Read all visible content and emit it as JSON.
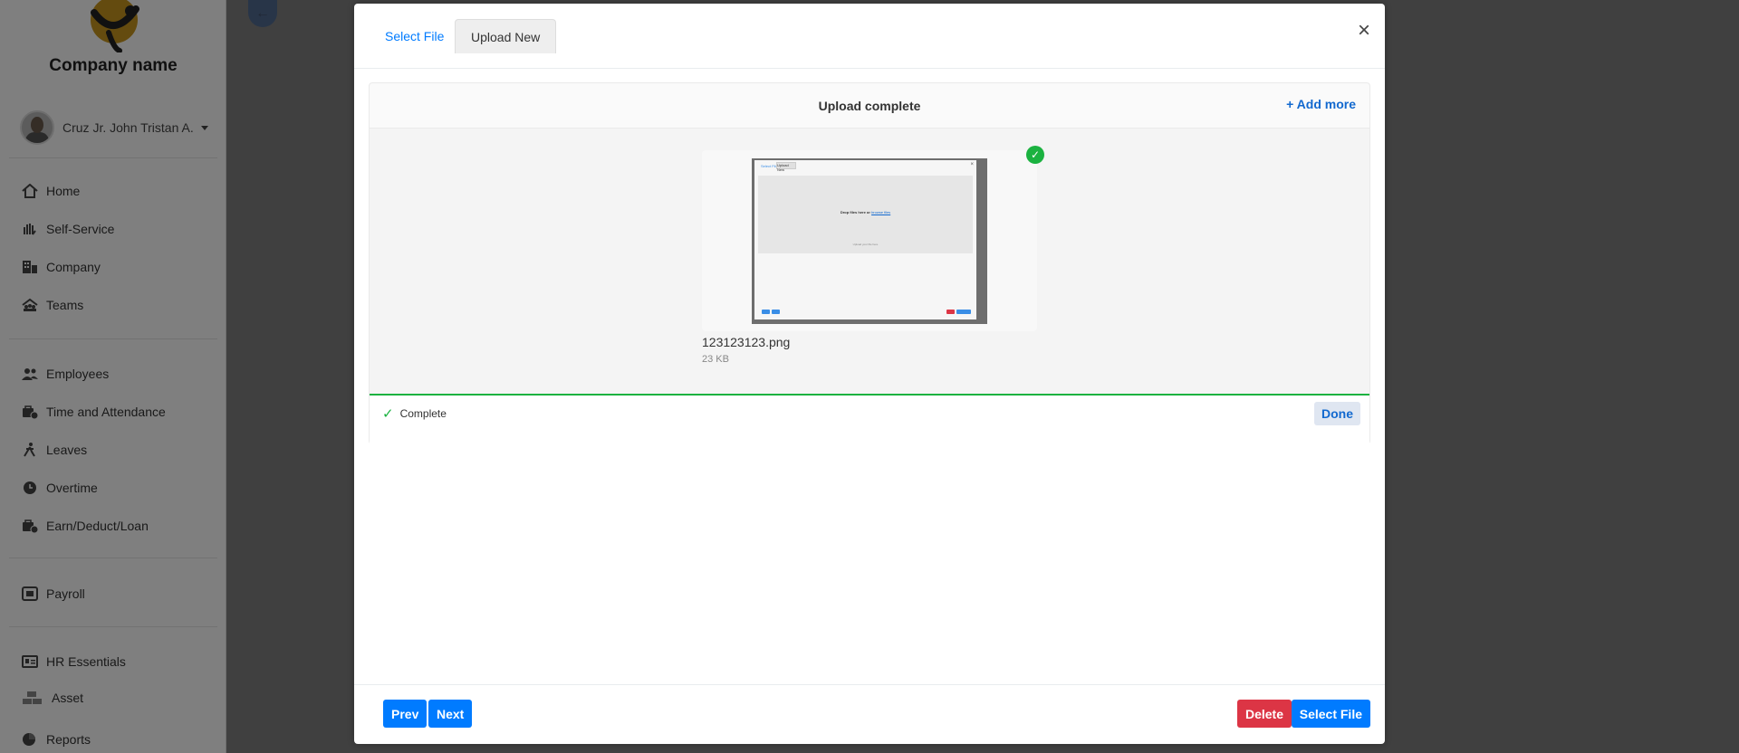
{
  "app": {
    "company_name": "Company name",
    "user_name": "Cruz Jr. John Tristan A."
  },
  "sidebar": {
    "items": [
      {
        "label": "Home",
        "icon": "home-icon"
      },
      {
        "label": "Self-Service",
        "icon": "hand-icon"
      },
      {
        "label": "Company",
        "icon": "building-icon"
      },
      {
        "label": "Teams",
        "icon": "team-icon"
      },
      {
        "label": "Employees",
        "icon": "users-icon"
      },
      {
        "label": "Time and Attendance",
        "icon": "clock-briefcase-icon"
      },
      {
        "label": "Leaves",
        "icon": "walking-icon"
      },
      {
        "label": "Overtime",
        "icon": "clock-icon"
      },
      {
        "label": "Earn/Deduct/Loan",
        "icon": "money-icon"
      },
      {
        "label": "Payroll",
        "icon": "payroll-icon"
      },
      {
        "label": "HR Essentials",
        "icon": "id-card-icon"
      },
      {
        "label": "Asset",
        "icon": "boxes-icon"
      },
      {
        "label": "Reports",
        "icon": "chart-icon"
      }
    ]
  },
  "modal": {
    "tabs": [
      "Select File",
      "Upload New"
    ],
    "close_glyph": "×",
    "uploader": {
      "status_title": "Upload complete",
      "add_more": "+ Add more",
      "file": {
        "name": "123123123.png",
        "size": "23 KB"
      },
      "thumbnail": {
        "tab1": "Select File",
        "tab2": "Upload New",
        "drop_text": "Drop files here or",
        "drop_link": "browse files",
        "caption": "Upload your file here"
      },
      "complete_label": "Complete",
      "done_label": "Done"
    },
    "footer": {
      "prev": "Prev",
      "next": "Next",
      "delete": "Delete",
      "select_file": "Select File"
    }
  },
  "colors": {
    "primary": "#007bff",
    "danger": "#dc3545",
    "success": "#1bb240",
    "link": "#1269cf",
    "logo_gold": "#c8961e"
  }
}
